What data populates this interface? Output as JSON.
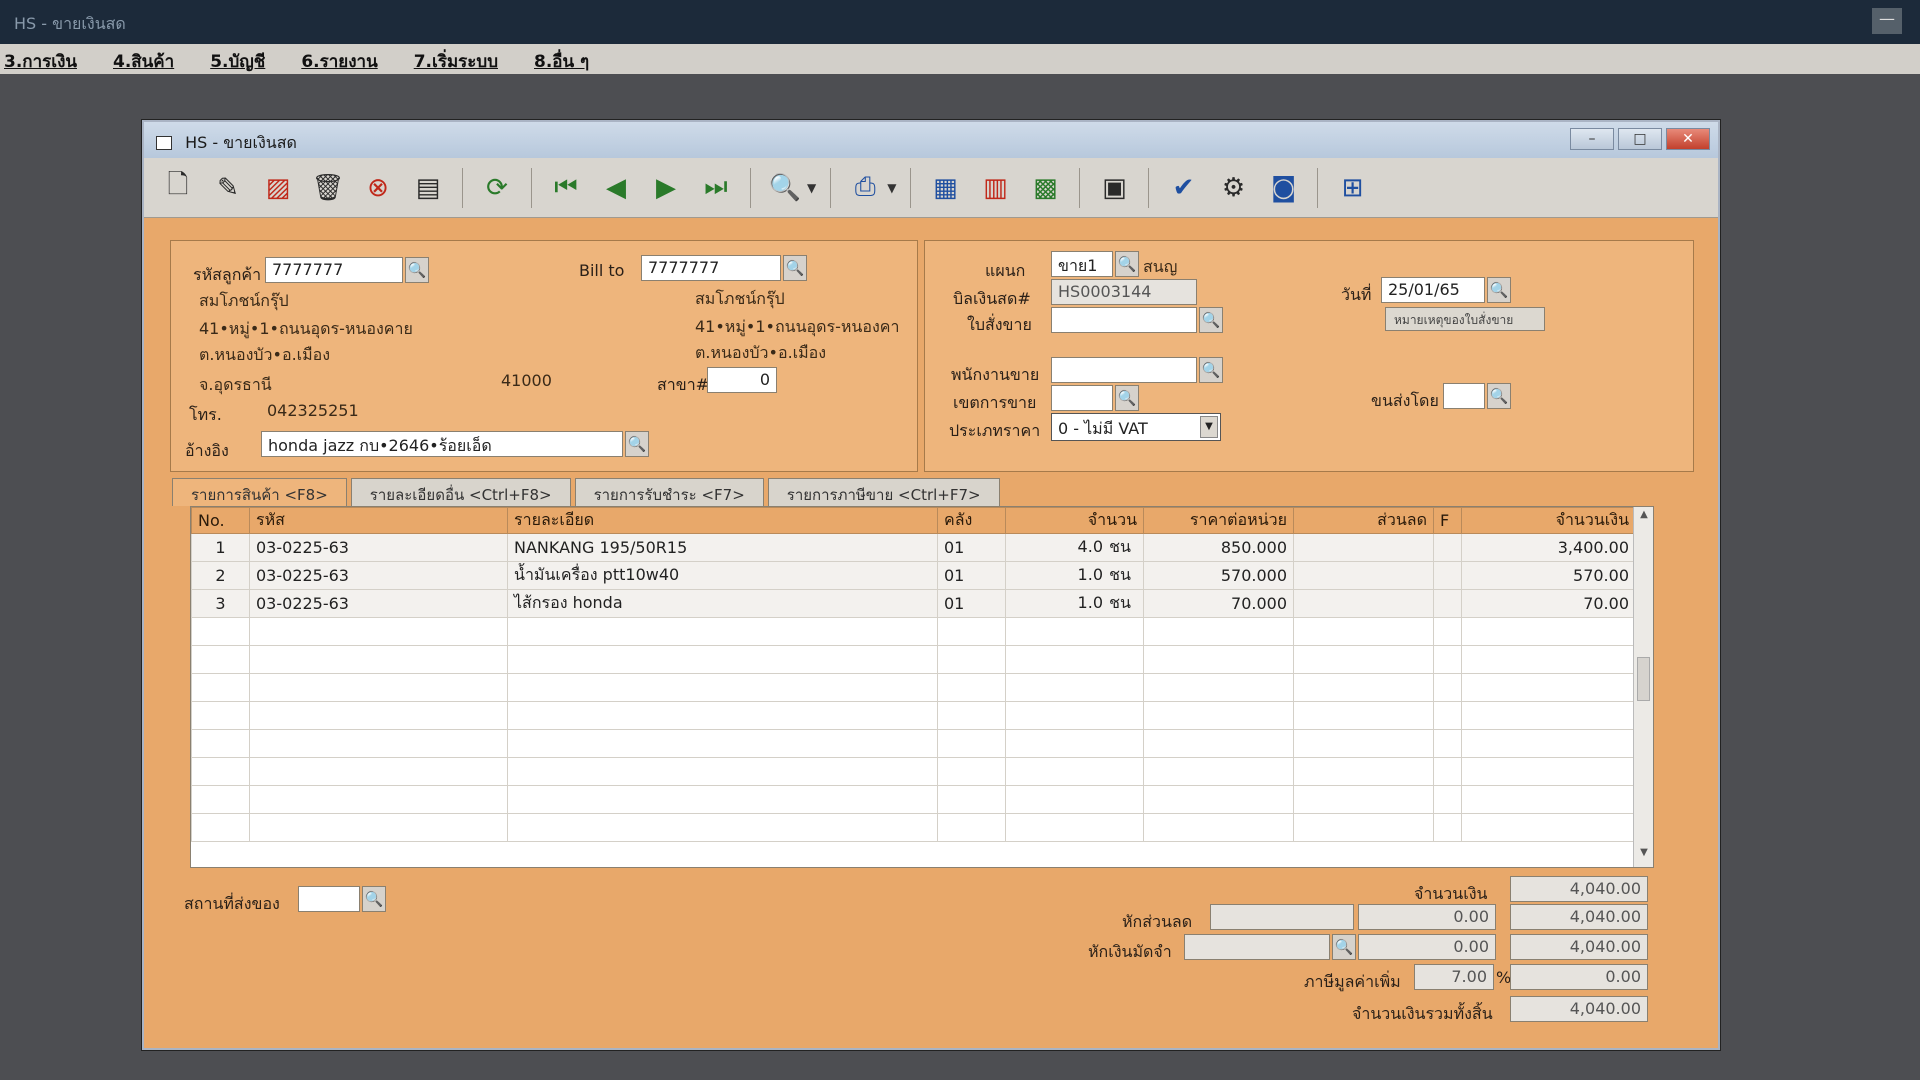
{
  "app": {
    "title": "HS - ขายเงินสด",
    "menu": [
      "3.การเงิน",
      "4.สินค้า",
      "5.บัญชี",
      "6.รายงาน",
      "7.เริ่มระบบ",
      "8.อื่น ๆ"
    ]
  },
  "window": {
    "title": "HS - ขายเงินสด"
  },
  "toolbar": {
    "icons": [
      "new-doc-icon",
      "edit-icon",
      "cancel-doc-icon",
      "trash-icon",
      "close-circle-icon",
      "save-icon",
      "refresh-icon",
      "first-record-icon",
      "prev-record-icon",
      "next-record-icon",
      "last-record-icon",
      "preview-icon",
      "print-icon",
      "calculator-icon",
      "report-icon",
      "sales-icon",
      "calendar-icon",
      "approve-icon",
      "tools-icon",
      "ok-icon",
      "network-icon"
    ]
  },
  "customer": {
    "code_label": "รหัสลูกค้า",
    "code": "7777777",
    "name": "สมโภชน์กรุ๊ป",
    "addr1": "41•หมู่•1•ถนนอุดร-หนองคาย",
    "addr2": "ต.หนองบัว•อ.เมือง",
    "addr3": "จ.อุดรธานี",
    "zip": "41000",
    "phone_label": "โทร.",
    "phone": "042325251",
    "ref_label": "อ้างอิง",
    "ref": "honda jazz กบ•2646•ร้อยเอ็ด"
  },
  "billto": {
    "label": "Bill to",
    "code": "7777777",
    "name": "สมโภชน์กรุ๊ป",
    "addr1": "41•หมู่•1•ถนนอุดร-หนองคา",
    "addr2": "ต.หนองบัว•อ.เมือง",
    "branch_label": "สาขา#",
    "branch": "0"
  },
  "doc": {
    "dept_label": "แผนก",
    "dept": "ขาย1",
    "dept_name": "สนญ",
    "bill_label": "บิลเงินสด#",
    "bill_no": "HS0003144",
    "date_label": "วันที่",
    "date": "25/01/65",
    "order_label": "ใบสั่งขาย",
    "order": "",
    "note_button": "หมายเหตุของใบสั่งขาย",
    "salesman_label": "พนักงานขาย",
    "salesman": "",
    "zone_label": "เขตการขาย",
    "zone": "",
    "ship_by_label": "ขนส่งโดย",
    "ship_by": "",
    "price_type_label": "ประเภทราคา",
    "price_type": "0 - ไม่มี VAT"
  },
  "tabs": [
    "รายการสินค้า <F8>",
    "รายละเอียดอื่น <Ctrl+F8>",
    "รายการรับชำระ <F7>",
    "รายการภาษีขาย <Ctrl+F7>"
  ],
  "grid": {
    "headers": {
      "no": "No.",
      "code": "รหัส",
      "desc": "รายละเอียด",
      "wh": "คลัง",
      "qty": "จำนวน",
      "price": "ราคาต่อหน่วย",
      "disc": "ส่วนลด",
      "f": "F",
      "amount": "จำนวนเงิน"
    },
    "rows": [
      {
        "no": "1",
        "code": "03-0225-63",
        "desc": "NANKANG 195/50R15",
        "wh": "01",
        "qty": "4.0",
        "unit": "ชน",
        "price": "850.000",
        "disc": "",
        "f": "",
        "amount": "3,400.00"
      },
      {
        "no": "2",
        "code": "03-0225-63",
        "desc": "น้ำมันเครื่อง ptt10w40",
        "wh": "01",
        "qty": "1.0",
        "unit": "ชน",
        "price": "570.000",
        "disc": "",
        "f": "",
        "amount": "570.00"
      },
      {
        "no": "3",
        "code": "03-0225-63",
        "desc": "ไส้กรอง honda",
        "wh": "01",
        "qty": "1.0",
        "unit": "ชน",
        "price": "70.000",
        "disc": "",
        "f": "",
        "amount": "70.00"
      }
    ]
  },
  "footer": {
    "ship_place_label": "สถานที่ส่งของ",
    "ship_place": "",
    "amount_label": "จำนวนเงิน",
    "amount": "4,040.00",
    "discount_label": "หักส่วนลด",
    "discount_text": "",
    "discount_value": "0.00",
    "after_discount": "4,040.00",
    "deposit_label": "หักเงินมัดจำ",
    "deposit_text": "",
    "deposit_value": "0.00",
    "after_deposit": "4,040.00",
    "vat_label": "ภาษีมูลค่าเพิ่ม",
    "vat_rate": "7.00",
    "vat_pct": "%",
    "vat_amount": "0.00",
    "total_label": "จำนวนเงินรวมทั้งสิ้น",
    "total": "4,040.00"
  }
}
